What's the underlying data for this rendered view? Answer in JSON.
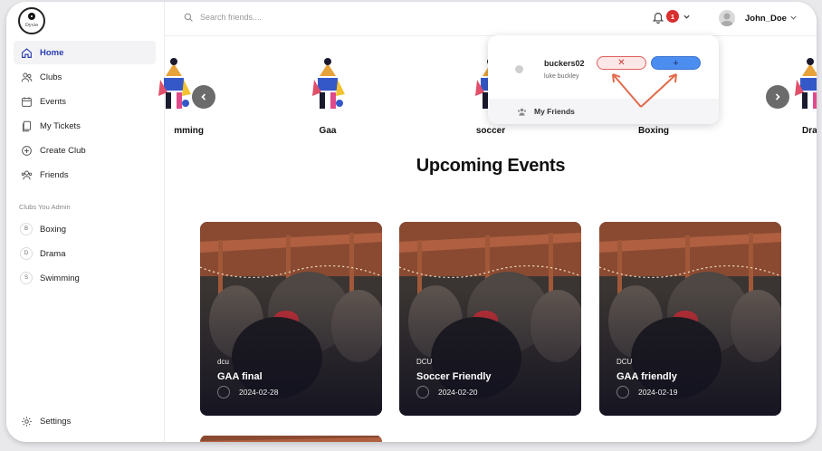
{
  "app": {
    "logo_text": "Dyvie"
  },
  "sidebar": {
    "nav": [
      {
        "label": "Home",
        "icon": "home-icon",
        "active": true
      },
      {
        "label": "Clubs",
        "icon": "users-icon"
      },
      {
        "label": "Events",
        "icon": "calendar-icon"
      },
      {
        "label": "My Tickets",
        "icon": "ticket-icon"
      },
      {
        "label": "Create Club",
        "icon": "plus-circle-icon"
      },
      {
        "label": "Friends",
        "icon": "friends-icon"
      }
    ],
    "admin_label": "Clubs You Admin",
    "admin_clubs": [
      {
        "initial": "B",
        "label": "Boxing"
      },
      {
        "initial": "D",
        "label": "Drama"
      },
      {
        "initial": "S",
        "label": "Swimming"
      }
    ],
    "settings_label": "Settings"
  },
  "topbar": {
    "search_placeholder": "Search friends....",
    "notification_count": "1",
    "username": "John_Doe"
  },
  "carousel": {
    "clubs": [
      "mming",
      "Gaa",
      "soccer",
      "Boxing",
      "Dra"
    ]
  },
  "friend_request": {
    "username": "buckers02",
    "real_name": "luke buckley",
    "reject_label": "✕",
    "accept_label": "+",
    "footer_label": "My Friends"
  },
  "events_title": "Upcoming Events",
  "events": [
    {
      "club": "dcu",
      "title": "GAA final",
      "date": "2024-02-28"
    },
    {
      "club": "DCU",
      "title": "Soccer Friendly",
      "date": "2024-02-20"
    },
    {
      "club": "DCU",
      "title": "GAA friendly",
      "date": "2024-02-19"
    }
  ],
  "colors": {
    "accent": "#2a3db0",
    "notification": "#d92f2f",
    "accept": "#4c8df0",
    "reject": "#e06060"
  }
}
